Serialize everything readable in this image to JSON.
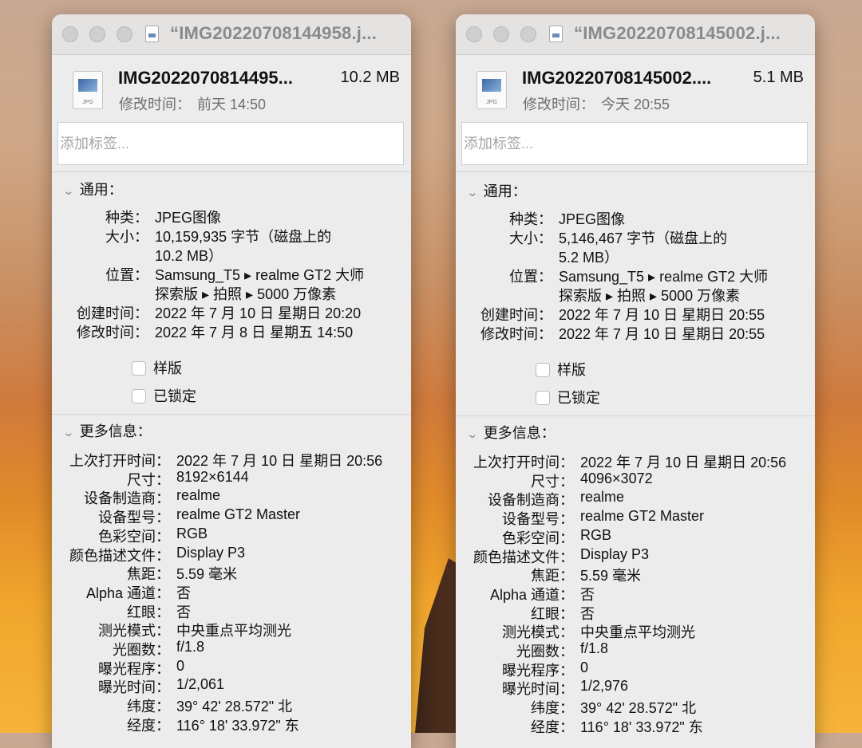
{
  "windows": [
    {
      "title": "“IMG20220708144958.j...",
      "file_name": "IMG2022070814495...",
      "file_size": "10.2 MB",
      "modified_label": "修改时间：",
      "modified_value": "前天 14:50",
      "tags_placeholder": "添加标签...",
      "general_heading": "通用：",
      "general": [
        {
          "key": "种类：",
          "value": "JPEG图像"
        },
        {
          "key": "大小：",
          "value": "10,159,935 字节（磁盘上的"
        },
        {
          "key": "",
          "value": "10.2 MB）"
        },
        {
          "key": "位置：",
          "value": "Samsung_T5 ▸ realme GT2 大师"
        },
        {
          "key": "",
          "value": "探索版 ▸ 拍照 ▸ 5000 万像素"
        },
        {
          "key": "创建时间：",
          "value": "2022 年 7 月 10 日 星期日 20:20"
        },
        {
          "key": "修改时间：",
          "value": "2022 年 7 月 8 日 星期五 14:50"
        }
      ],
      "checkbox_stationery": "样版",
      "checkbox_locked": "已锁定",
      "more_heading": "更多信息：",
      "more": [
        {
          "key": "上次打开时间：",
          "value": "2022 年 7 月 10 日 星期日 20:56"
        },
        {
          "key": "尺寸：",
          "value": "8192×6144"
        },
        {
          "key": "设备制造商：",
          "value": "realme"
        },
        {
          "key": "设备型号：",
          "value": "realme GT2 Master"
        },
        {
          "key": "色彩空间：",
          "value": "RGB"
        },
        {
          "key": "颜色描述文件：",
          "value": "Display P3"
        },
        {
          "key": "焦距：",
          "value": "5.59 毫米"
        },
        {
          "key": "Alpha 通道：",
          "value": "否"
        },
        {
          "key": "红眼：",
          "value": "否"
        },
        {
          "key": "测光模式：",
          "value": "中央重点平均测光"
        },
        {
          "key": "光圈数：",
          "value": "f/1.8"
        },
        {
          "key": "曝光程序：",
          "value": "0"
        },
        {
          "key": "曝光时间：",
          "value": "1/2,061"
        },
        {
          "key": "纬度：",
          "value": "39° 42' 28.572\" 北"
        },
        {
          "key": "经度：",
          "value": "116° 18' 33.972\" 东"
        }
      ]
    },
    {
      "title": "“IMG20220708145002.j...",
      "file_name": "IMG20220708145002....",
      "file_size": "5.1 MB",
      "modified_label": "修改时间：",
      "modified_value": "今天 20:55",
      "tags_placeholder": "添加标签...",
      "general_heading": "通用：",
      "general": [
        {
          "key": "种类：",
          "value": "JPEG图像"
        },
        {
          "key": "大小：",
          "value": "5,146,467 字节（磁盘上的"
        },
        {
          "key": "",
          "value": "5.2 MB）"
        },
        {
          "key": "位置：",
          "value": "Samsung_T5 ▸ realme GT2 大师"
        },
        {
          "key": "",
          "value": "探索版 ▸ 拍照 ▸ 5000 万像素"
        },
        {
          "key": "创建时间：",
          "value": "2022 年 7 月 10 日 星期日 20:55"
        },
        {
          "key": "修改时间：",
          "value": "2022 年 7 月 10 日 星期日 20:55"
        }
      ],
      "checkbox_stationery": "样版",
      "checkbox_locked": "已锁定",
      "more_heading": "更多信息：",
      "more": [
        {
          "key": "上次打开时间：",
          "value": "2022 年 7 月 10 日 星期日 20:56"
        },
        {
          "key": "尺寸：",
          "value": "4096×3072"
        },
        {
          "key": "设备制造商：",
          "value": "realme"
        },
        {
          "key": "设备型号：",
          "value": "realme GT2 Master"
        },
        {
          "key": "色彩空间：",
          "value": "RGB"
        },
        {
          "key": "颜色描述文件：",
          "value": "Display P3"
        },
        {
          "key": "焦距：",
          "value": "5.59 毫米"
        },
        {
          "key": "Alpha 通道：",
          "value": "否"
        },
        {
          "key": "红眼：",
          "value": "否"
        },
        {
          "key": "测光模式：",
          "value": "中央重点平均测光"
        },
        {
          "key": "光圈数：",
          "value": "f/1.8"
        },
        {
          "key": "曝光程序：",
          "value": "0"
        },
        {
          "key": "曝光时间：",
          "value": "1/2,976"
        },
        {
          "key": "纬度：",
          "value": "39° 42' 28.572\" 北"
        },
        {
          "key": "经度：",
          "value": "116° 18' 33.972\" 东"
        }
      ]
    }
  ],
  "icons": {
    "section_toggle": "chevron-down-icon",
    "file_type_label": "JPG"
  }
}
